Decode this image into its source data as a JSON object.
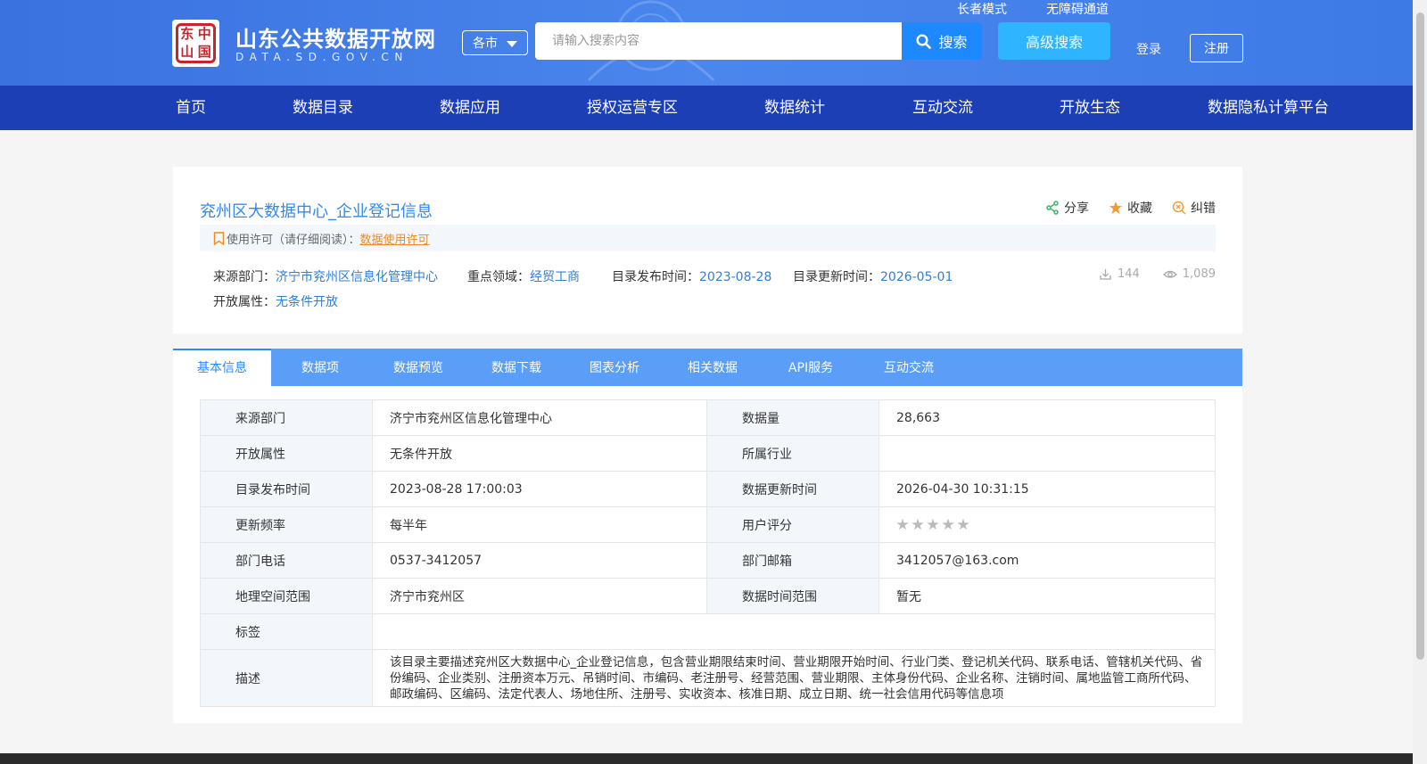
{
  "header": {
    "logo_seal": [
      "中",
      "国",
      "山",
      "东"
    ],
    "site_title": "山东公共数据开放网",
    "site_domain": "DATA.SD.GOV.CN",
    "city_select": "各市",
    "search_placeholder": "请输入搜索内容",
    "search_button": "搜索",
    "advanced_search": "高级搜索",
    "elder_mode": "长者模式",
    "accessibility": "无障碍通道",
    "login": "登录",
    "register": "注册"
  },
  "nav": {
    "items": [
      "首页",
      "数据目录",
      "数据应用",
      "授权运营专区",
      "数据统计",
      "互动交流",
      "开放生态",
      "数据隐私计算平台"
    ]
  },
  "dataset": {
    "title": "兖州区大数据中心_企业登记信息",
    "actions": {
      "share": "分享",
      "favorite": "收藏",
      "report": "纠错"
    },
    "license_label": "使用许可（请仔细阅读）：",
    "license_link": "数据使用许可",
    "source_label": "来源部门：",
    "source_value": "济宁市兖州区信息化管理中心",
    "domain_label": "重点领域：",
    "domain_value": "经贸工商",
    "publish_label": "目录发布时间：",
    "publish_value": "2023-08-28",
    "update_label": "目录更新时间：",
    "update_value": "2026-05-01",
    "open_label": "开放属性：",
    "open_value": "无条件开放",
    "downloads": "144",
    "views": "1,089"
  },
  "tabs": [
    "基本信息",
    "数据项",
    "数据预览",
    "数据下载",
    "图表分析",
    "相关数据",
    "API服务",
    "互动交流"
  ],
  "info_table": {
    "rows": [
      {
        "l1": "来源部门",
        "v1": "济宁市兖州区信息化管理中心",
        "l2": "数据量",
        "v2": "28,663"
      },
      {
        "l1": "开放属性",
        "v1": "无条件开放",
        "l2": "所属行业",
        "v2": ""
      },
      {
        "l1": "目录发布时间",
        "v1": "2023-08-28 17:00:03",
        "l2": "数据更新时间",
        "v2": "2026-04-30 10:31:15"
      },
      {
        "l1": "更新频率",
        "v1": "每半年",
        "l2": "用户评分",
        "v2": ""
      },
      {
        "l1": "部门电话",
        "v1": "0537-3412057",
        "l2": "部门邮箱",
        "v2": "3412057@163.com"
      },
      {
        "l1": "地理空间范围",
        "v1": "济宁市兖州区",
        "l2": "数据时间范围",
        "v2": "暂无"
      }
    ],
    "rating": 0,
    "tags_label": "标签",
    "tags_value": "",
    "desc_label": "描述",
    "desc_value": "该目录主要描述兖州区大数据中心_企业登记信息，包含营业期限结束时间、营业期限开始时间、行业门类、登记机关代码、联系电话、管辖机关代码、省份编码、企业类别、注册资本万元、吊销时间、市编码、老注册号、经营范围、营业期限、主体身份代码、企业名称、注销时间、属地监管工商所代码、邮政编码、区编码、法定代表人、场地住所、注册号、实收资本、核准日期、成立日期、统一社会信用代码等信息项"
  },
  "colors": {
    "header_blue": "#3a72e0",
    "nav_blue": "#1d3fb6",
    "tab_blue": "#5b9ef7",
    "link_blue": "#2f7fd6",
    "license_orange": "#f08a24"
  }
}
